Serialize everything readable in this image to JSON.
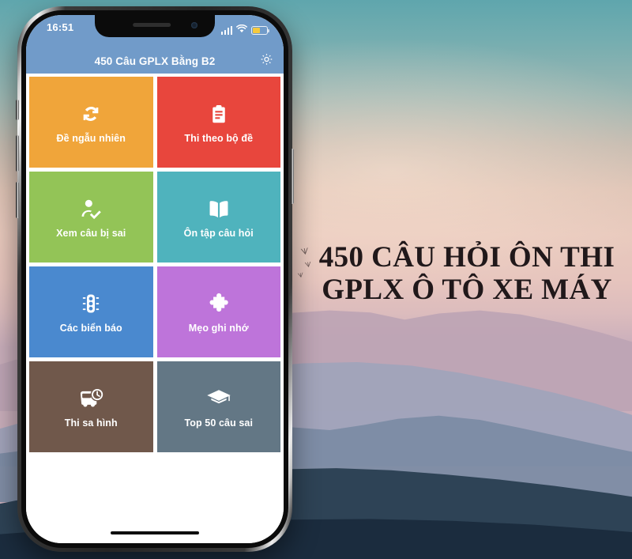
{
  "poster": {
    "headline_line1": "450 CÂU HỎI ÔN THI",
    "headline_line2": "GPLX Ô TÔ XE MÁY",
    "background_description": "sunset-mountain-photo",
    "colors": {
      "sky_top": "#5fa6ad",
      "sky_mid": "#e8c9bd",
      "ridge_far": "#bda4b4",
      "ridge_mid": "#a0a3bb",
      "ridge_near": "#2e4356",
      "headline_text": "#20181a"
    }
  },
  "phone": {
    "status_bar": {
      "time": "16:51",
      "signal_icon": "cellular-bars-icon",
      "wifi_icon": "wifi-icon",
      "battery_icon": "battery-icon",
      "battery_fill_color": "#f5c93c"
    },
    "nav_bar": {
      "title": "450 Câu GPLX Bằng B2",
      "settings_icon": "gear-icon",
      "background_color": "#719bc9"
    },
    "home_indicator": "home-indicator-bar"
  },
  "menu": {
    "tiles": [
      {
        "label": "Đề ngẫu nhiên",
        "icon": "refresh-sync-icon",
        "color": "#f0a53a"
      },
      {
        "label": "Thi theo bộ đề",
        "icon": "clipboard-icon",
        "color": "#e8463d"
      },
      {
        "label": "Xem câu bị sai",
        "icon": "person-check-icon",
        "color": "#93c457"
      },
      {
        "label": "Ôn tập câu hỏi",
        "icon": "open-book-icon",
        "color": "#4fb3bd"
      },
      {
        "label": "Các biển báo",
        "icon": "traffic-light-icon",
        "color": "#4a89cf"
      },
      {
        "label": "Mẹo ghi nhớ",
        "icon": "puzzle-piece-icon",
        "color": "#be74da"
      },
      {
        "label": "Thi sa hình",
        "icon": "bus-clock-icon",
        "color": "#70584b"
      },
      {
        "label": "Top 50 câu sai",
        "icon": "graduation-cap-icon",
        "color": "#637785"
      }
    ]
  }
}
